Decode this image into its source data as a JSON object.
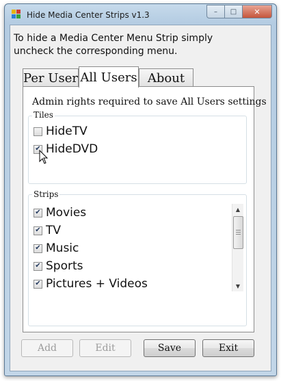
{
  "window": {
    "title": "Hide Media Center Strips v1.3"
  },
  "caption_buttons": {
    "minimize": "–",
    "maximize": "□",
    "close": "✕"
  },
  "description": "To hide a Media Center Menu Strip simply uncheck the corresponding menu.",
  "tabs": [
    {
      "label": "Per User",
      "active": false
    },
    {
      "label": "All Users",
      "active": true
    },
    {
      "label": "About",
      "active": false
    }
  ],
  "admin_note": "Admin rights required to save All Users settings",
  "tiles": {
    "legend": "Tiles",
    "items": [
      {
        "label": "HideTV",
        "checked": false
      },
      {
        "label": "HideDVD",
        "checked": true
      }
    ]
  },
  "strips": {
    "legend": "Strips",
    "items": [
      {
        "label": "Movies",
        "checked": true
      },
      {
        "label": "TV",
        "checked": true
      },
      {
        "label": "Music",
        "checked": true
      },
      {
        "label": "Sports",
        "checked": true
      },
      {
        "label": "Pictures + Videos",
        "checked": true
      }
    ]
  },
  "buttons": {
    "add": {
      "label": "Add",
      "enabled": false
    },
    "edit": {
      "label": "Edit",
      "enabled": false
    },
    "save": {
      "label": "Save",
      "enabled": true
    },
    "exit": {
      "label": "Exit",
      "enabled": true
    }
  },
  "check_glyph": "✔",
  "scroll_up_glyph": "▲",
  "scroll_down_glyph": "▼"
}
